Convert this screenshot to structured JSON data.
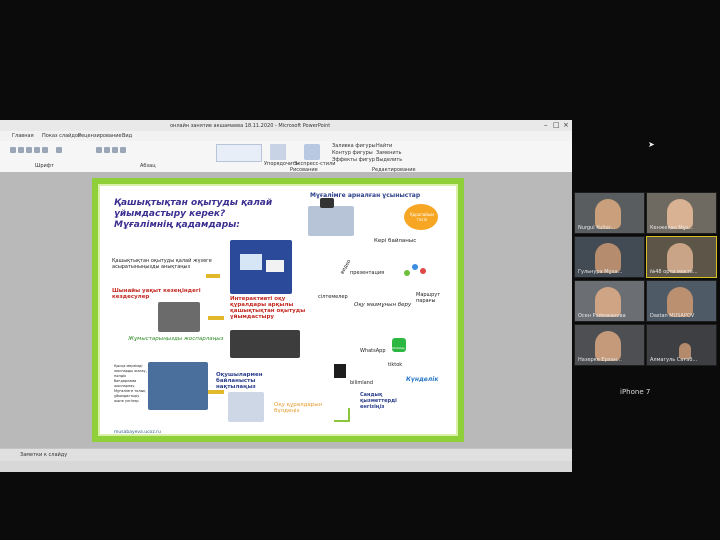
{
  "window": {
    "title": "онлайн занятие акшамаева 18.11.2020 - Microsoft PowerPoint",
    "menu": [
      "Главная",
      "Показ слайдов",
      "Рецензирование",
      "Вид"
    ],
    "ribbon_labels": {
      "paste": "Буфер обмена",
      "slides": "Слайды",
      "font": "Шрифт",
      "paragraph": "Абзац",
      "arrange": "Упорядочить",
      "styles": "Экспресс-стили",
      "drawing": "Рисование",
      "find": "Найти",
      "replace": "Заменить",
      "select": "Выделить",
      "editing": "Редактирование",
      "fill": "Заливка фигуры",
      "outline": "Контур фигуры",
      "effects": "Эффекты фигур"
    },
    "status": "Заметки к слайду"
  },
  "slide": {
    "title": "Қашықтықтан оқытуды қалай ұйымдастыру керек? Мұғалімнің қадамдары:",
    "right_header": "Мұғалімге арналған ұсыныстар",
    "items": {
      "step1": "Қашықтықтан оқытуды қалай жүзеге асыратыныңызды анықтаңыз",
      "step2": "Шынайы уақыт кезеңіндегі кездесулер",
      "step3": "Интерактивті оқу құралдары арқылы қашықтықтан оқытуды ұйымдастыру",
      "step4": "Жұмыстарыңызды жоспарлаңыз",
      "step5": "Оқушылармен байланысты нақтылаңыз",
      "step6": "Оқу құралдарын бүлдеңіз",
      "note_left": "Қысқа мерзімді жоспарды жасау, пәндік бағдарлама жоспарлау. Мұғалімге толық ұйымдастыру және үлгілер",
      "feedback": "Кері байланыс",
      "video": "видео",
      "presentation": "презентация",
      "links": "сілтемелер",
      "content": "Оқу мазмұнын беру",
      "route": "Маршрут парағы",
      "whatsapp": "WhatsApp",
      "whatsapp_logo": "WhatsApp",
      "tiktok": "tiktok",
      "bilimland": "bilimland",
      "kundelik": "Күнделік",
      "digital": "Сандық қызметтерді енгізіңіз",
      "bubble": "Қарапайым тәсіл",
      "footer": "musabayeva.ucoz.ru"
    }
  },
  "participants": [
    {
      "name": "Nurgul Kultar..."
    },
    {
      "name": "Кенжеқан Мұх..."
    },
    {
      "name": "Гульнура Мұха..."
    },
    {
      "name": "№48 орта мекте..."
    },
    {
      "name": "Осен Раймжанова"
    },
    {
      "name": "Dastan MUSAPOV"
    },
    {
      "name": "Назерке Ерхан..."
    },
    {
      "name": "Алмагуль Сағаб..."
    }
  ],
  "device_label": "iPhone 7"
}
